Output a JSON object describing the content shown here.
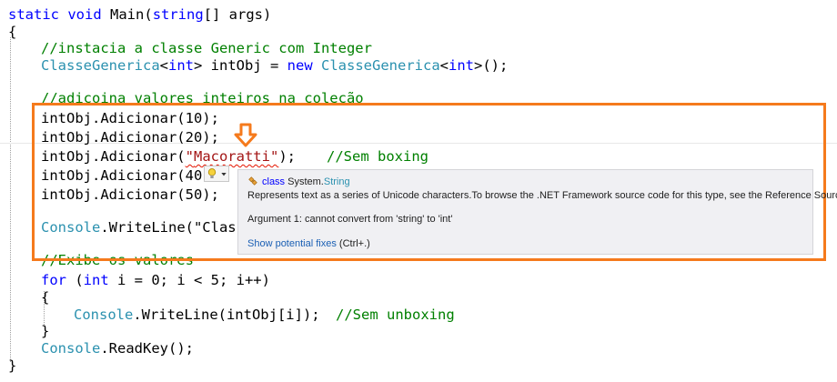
{
  "code": {
    "l1": {
      "kw1": "static",
      "kw2": "void",
      "name": "Main(",
      "kw3": "string",
      "rest": "[] args)"
    },
    "l2": "{",
    "l3": "//instacia a classe Generic com Integer",
    "l4": {
      "t1": "ClasseGenerica",
      "p1": "<",
      "k1": "int",
      "p2": "> intObj = ",
      "k2": "new",
      "sp": " ",
      "t2": "ClasseGenerica",
      "p3": "<",
      "k3": "int",
      "p4": ">();"
    },
    "l5": "//adicoina valores inteiros na coleção",
    "l6": "intObj.Adicionar(10);",
    "l7": "intObj.Adicionar(20);",
    "l8": {
      "pre": "intObj.Adicionar(",
      "q1": "\"",
      "str": "Macoratti",
      "q2": "\"",
      "post": ");",
      "comment": "//Sem boxing"
    },
    "l9": "intObj.Adicionar(40)",
    "l10": "intObj.Adicionar(50);",
    "l11": {
      "t": "Console",
      "rest": ".WriteLine(\"Class"
    },
    "l12": "//Exibe os valores",
    "l13": {
      "kw": "for",
      "p1": " (",
      "k2": "int",
      "rest": " i = 0; i < 5; i++)"
    },
    "l14": "{",
    "l15": {
      "t": "Console",
      "rest": ".WriteLine(intObj[i]);",
      "comment": "//Sem unboxing"
    },
    "l16": "}",
    "l17": {
      "t": "Console",
      "rest": ".ReadKey();"
    },
    "l18": "}"
  },
  "tooltip": {
    "kind": "class",
    "type_ns": "System.",
    "type_name": "String",
    "description": "Represents text as a series of Unicode characters.To browse the .NET Framework source code for this type, see the Reference Source.",
    "error": "Argument 1: cannot convert from 'string' to 'int'",
    "fix_link": "Show potential fixes",
    "fix_shortcut": "(Ctrl+.)"
  },
  "colors": {
    "keyword": "#0000ff",
    "type": "#2b91af",
    "comment": "#008000",
    "string": "#a31515",
    "highlight_box": "#f57a1c",
    "squiggle": "#e51400"
  },
  "icons": {
    "arrow": "down-arrow-icon",
    "lightbulb": "lightbulb-icon",
    "class": "class-icon"
  }
}
